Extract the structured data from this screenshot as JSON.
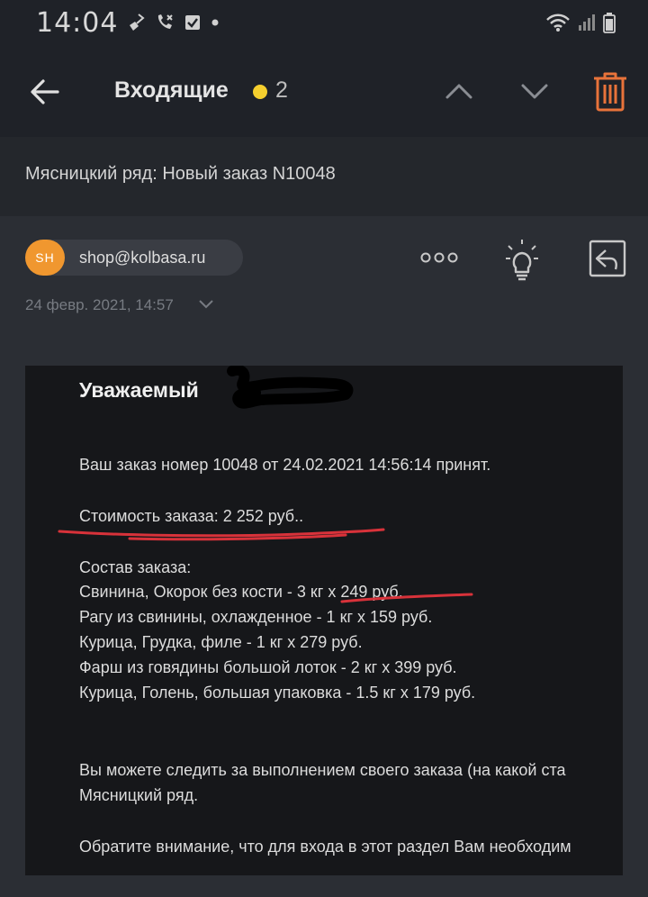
{
  "status_bar": {
    "time": "14:04"
  },
  "header": {
    "title": "Входящие",
    "unread_count": "2"
  },
  "subject": "Мясницкий ряд: Новый заказ N10048",
  "sender": {
    "avatar_initials": "SH",
    "email": "shop@kolbasa.ru",
    "date": "24 февр. 2021, 14:57"
  },
  "body": {
    "greeting": "Уважаемый",
    "line_accepted": "Ваш заказ номер 10048 от 24.02.2021 14:56:14 принят.",
    "line_cost": "Стоимость заказа: 2 252 руб..",
    "composition_label": "Состав заказа:",
    "items": [
      "Свинина, Окорок без кости - 3 кг х 249 руб.",
      "Рагу из свинины, охлажденное - 1 кг х 159 руб.",
      "Курица, Грудка, филе - 1 кг х 279 руб.",
      "Фарш из говядины большой лоток - 2 кг х 399 руб.",
      "Курица, Голень, большая упаковка - 1.5 кг х 179 руб."
    ],
    "line_track_1": "Вы можете следить за выполнением своего заказа (на какой ста",
    "line_track_2": "Мясницкий ряд.",
    "line_note": "Обратите внимание, что для входа в этот раздел Вам необходим"
  },
  "colors": {
    "accent_yellow": "#f5cf2e",
    "trash_orange": "#e8733a",
    "avatar_orange": "#f0972f",
    "annotation_red": "#d8323a"
  },
  "icons": [
    "back-arrow-icon",
    "chevron-up-icon",
    "chevron-down-icon",
    "trash-icon",
    "more-dots-icon",
    "lightbulb-icon",
    "reply-icon"
  ]
}
